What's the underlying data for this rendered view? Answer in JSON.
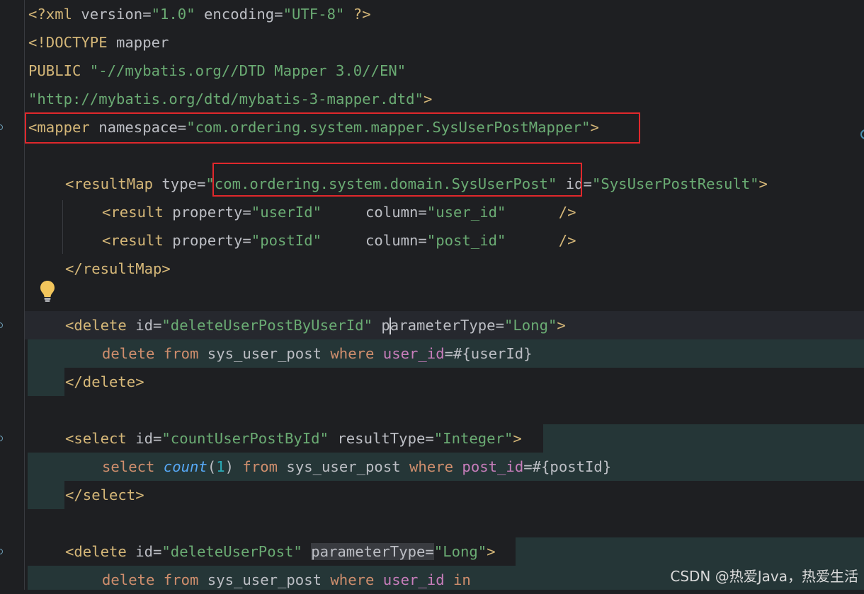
{
  "editor": {
    "lines": {
      "l1": {
        "t1": "<?xml",
        "a1": " version=",
        "s1": "\"1.0\"",
        "a2": " encoding=",
        "s2": "\"UTF-8\"",
        "t2": " ?>"
      },
      "l2": {
        "t1": "<!DOCTYPE",
        "a1": " mapper"
      },
      "l3": {
        "t1": "PUBLIC",
        "s1": " \"-//mybatis.org//DTD Mapper 3.0//EN\""
      },
      "l4": {
        "s1": "\"http://mybatis.org/dtd/mybatis-3-mapper.dtd\"",
        "t1": ">"
      },
      "l5": {
        "t1": "<mapper",
        "a1": " namespace=",
        "s1": "\"com.ordering.system.mapper.SysUserPostMapper\"",
        "t2": ">"
      },
      "l7": {
        "t1": "<resultMap",
        "a1": " type=",
        "s1": "\"com.ordering.system.domain.SysUserPost\"",
        "a2": " id=",
        "s2": "\"SysUserPostResult\"",
        "t2": ">"
      },
      "l8": {
        "t1": "<result",
        "a1": " property=",
        "s1": "\"userId\"",
        "a2": "     column=",
        "s2": "\"user_id\"",
        "t2": "      />"
      },
      "l9": {
        "t1": "<result",
        "a1": " property=",
        "s1": "\"postId\"",
        "a2": "     column=",
        "s2": "\"post_id\"",
        "t2": "      />"
      },
      "l10": {
        "t1": "</resultMap>"
      },
      "l12": {
        "t1": "<delete",
        "a1": " id=",
        "s1": "\"deleteUserPostByUserId\"",
        "a2a": " p",
        "a2b": "arameterType=",
        "s2": "\"Long\"",
        "t2": ">"
      },
      "l13": {
        "k1": "delete",
        "k2": " from",
        "p1": " sys_user_post",
        "k3": " where",
        "c1": " user_id",
        "p2": "=#{userId}"
      },
      "l14": {
        "t1": "</delete>"
      },
      "l16": {
        "t1": "<select",
        "a1": " id=",
        "s1": "\"countUserPostById\"",
        "a2": " resultType=",
        "s2": "\"Integer\"",
        "t2": ">"
      },
      "l17": {
        "k1": "select",
        "f1": " count",
        "p1": "(",
        "n1": "1",
        "p2": ")",
        "k2": " from",
        "p3": " sys_user_post",
        "k3": " where",
        "c1": " post_id",
        "p4": "=#{postId}"
      },
      "l18": {
        "t1": "</select>"
      },
      "l20": {
        "t1": "<delete",
        "a1": " id=",
        "s1": "\"deleteUserPost\"",
        "a2": "parameterType=",
        "s2": "\"Long\"",
        "t2": ">"
      },
      "l21": {
        "k1": "delete",
        "k2": " from",
        "p1": " sys_user_post",
        "k3": " where",
        "c1": " user_id",
        "k4": " in"
      }
    }
  },
  "watermark": "CSDN @热爱Java，热爱生活",
  "icons": {
    "bulb": "lightbulb-icon",
    "gutter": "implementation-marker-icon"
  },
  "colors": {
    "background": "#1e1f22",
    "tag": "#d5b778",
    "string": "#6aab73",
    "keyword": "#cf8e6d",
    "column": "#c77dbb",
    "function": "#56a8f5",
    "number": "#2aacb8",
    "highlight_box": "#e0282c"
  }
}
